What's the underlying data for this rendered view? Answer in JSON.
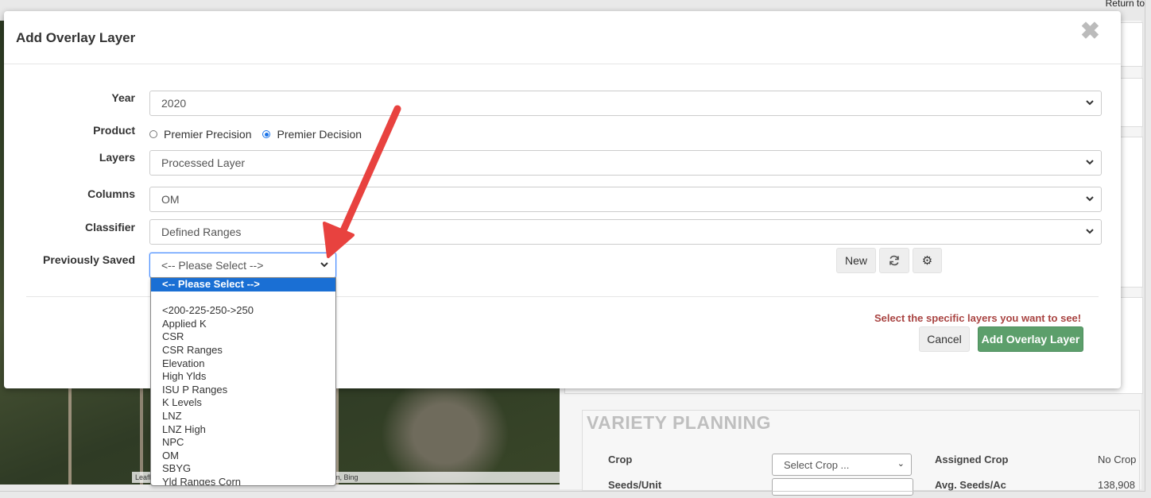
{
  "background": {
    "return_link": "Return to",
    "map_attribution": "Leaflet | © CNES (2024) Distribution Airbus DS, © 2024 TomTom, Bing",
    "variety_planning": {
      "title": "VARIETY PLANNING",
      "crop_label": "Crop",
      "seeds_unit_label": "Seeds/Unit",
      "crop_select": "Select Crop ...",
      "assigned_crop_label": "Assigned Crop",
      "assigned_crop_value": "No Crop",
      "avg_seeds_label": "Avg. Seeds/Ac",
      "avg_seeds_value": "138,908"
    }
  },
  "modal": {
    "title": "Add Overlay Layer",
    "year": {
      "label": "Year",
      "value": "2020"
    },
    "product": {
      "label": "Product",
      "options": [
        {
          "label": "Premier Precision",
          "checked": false
        },
        {
          "label": "Premier Decision",
          "checked": true
        }
      ]
    },
    "layers": {
      "label": "Layers",
      "value": "Processed Layer"
    },
    "columns": {
      "label": "Columns",
      "value": "OM"
    },
    "classifier": {
      "label": "Classifier",
      "value": "Defined Ranges"
    },
    "previously_saved": {
      "label": "Previously Saved",
      "value": "<-- Please Select -->",
      "options": [
        "<-- Please Select -->",
        "",
        "<200-225-250->250",
        "Applied K",
        "CSR",
        "CSR Ranges",
        "Elevation",
        "High Ylds",
        "ISU P Ranges",
        "K Levels",
        "LNZ",
        "LNZ High",
        "NPC",
        "OM",
        "SBYG",
        "Yld Ranges Corn"
      ]
    },
    "new_label": "New",
    "hint": "Select the specific layers you want to see!",
    "cancel_label": "Cancel",
    "add_label": "Add Overlay Layer"
  },
  "colors": {
    "annotation_arrow": "#e8423f",
    "primary_button": "#5c9f6b",
    "hint_text": "#a94442",
    "selected_option": "#1a6fd4"
  }
}
